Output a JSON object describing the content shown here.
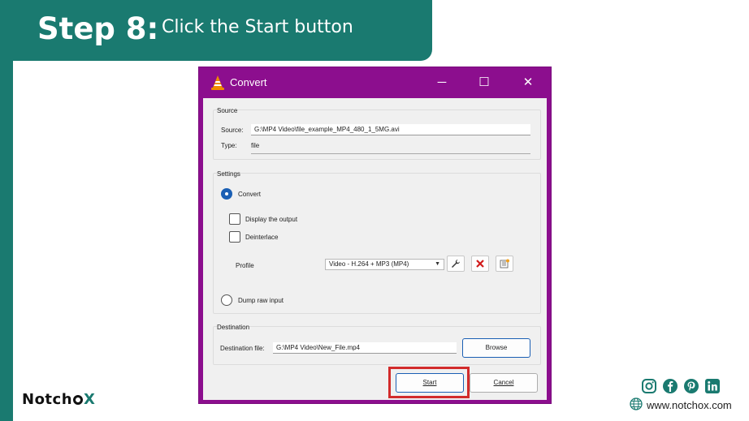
{
  "banner": {
    "step": "Step 8:",
    "instruction": "Click the Start button"
  },
  "window": {
    "title": "Convert",
    "controls": {
      "minimize": "─",
      "maximize": "☐",
      "close": "✕"
    }
  },
  "source": {
    "group_title": "Source",
    "source_label": "Source:",
    "source_value": "G:\\MP4 Video\\file_example_MP4_480_1_5MG.avi",
    "type_label": "Type:",
    "type_value": "file"
  },
  "settings": {
    "group_title": "Settings",
    "convert_label": "Convert",
    "display_output_label": "Display the output",
    "deinterlace_label": "Deinterlace",
    "profile_label": "Profile",
    "profile_selected": "Video - H.264 + MP3 (MP4)",
    "dump_raw_label": "Dump raw input"
  },
  "destination": {
    "group_title": "Destination",
    "file_label": "Destination file:",
    "file_value": "G:\\MP4 Video\\New_File.mp4",
    "browse_label": "Browse"
  },
  "buttons": {
    "start": "Start",
    "cancel": "Cancel"
  },
  "footer": {
    "logo_prefix": "Notch",
    "logo_x": "X",
    "website": "www.notchox.com",
    "icons": [
      "instagram-icon",
      "facebook-icon",
      "pinterest-icon",
      "linkedin-icon",
      "globe-icon"
    ]
  },
  "colors": {
    "teal": "#1a7a70",
    "window_frame": "#8c0e8e",
    "highlight": "#d22b2b",
    "accent": "#1a5fb4"
  }
}
